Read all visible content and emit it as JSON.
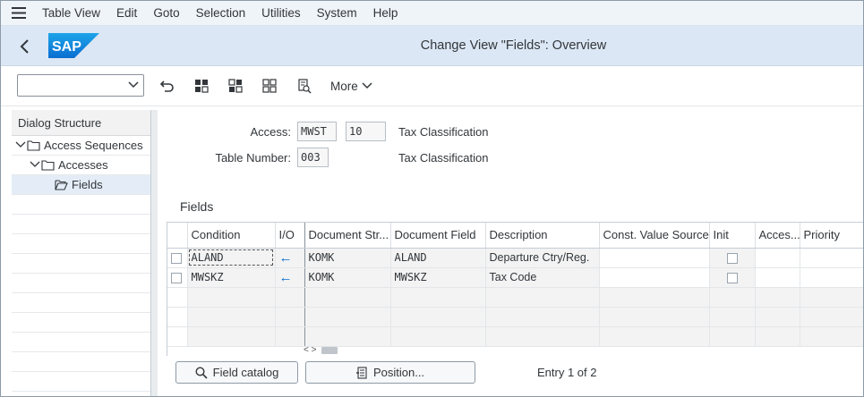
{
  "menu": {
    "items": [
      "Table View",
      "Edit",
      "Goto",
      "Selection",
      "Utilities",
      "System",
      "Help"
    ]
  },
  "titlebar": {
    "logo_text": "SAP",
    "title": "Change View \"Fields\": Overview"
  },
  "toolbar": {
    "command_field_value": "",
    "more_label": "More"
  },
  "dialog_structure": {
    "header": "Dialog Structure",
    "items": [
      {
        "label": "Access Sequences",
        "level": 0,
        "expanded": true,
        "selected": false
      },
      {
        "label": "Accesses",
        "level": 1,
        "expanded": true,
        "selected": false
      },
      {
        "label": "Fields",
        "level": 2,
        "expanded": false,
        "selected": true
      }
    ]
  },
  "header_fields": {
    "access_label": "Access:",
    "access_value": "MWST",
    "access_number": "10",
    "access_desc": "Tax Classification",
    "table_label": "Table Number:",
    "table_value": "003",
    "table_desc": "Tax Classification"
  },
  "fields_section": {
    "title": "Fields",
    "columns": [
      "Condition",
      "I/O",
      "Document Str...",
      "Document Field",
      "Description",
      "Const. Value Source",
      "Init",
      "Acces...",
      "Priority"
    ],
    "rows": [
      {
        "condition": "ALAND",
        "io": "←",
        "doc_structure": "KOMK",
        "doc_field": "ALAND",
        "description": "Departure Ctry/Reg.",
        "const_value_source": "",
        "init": false,
        "access": "",
        "priority": ""
      },
      {
        "condition": "MWSKZ",
        "io": "←",
        "doc_structure": "KOMK",
        "doc_field": "MWSKZ",
        "description": "Tax Code",
        "const_value_source": "",
        "init": false,
        "access": "",
        "priority": ""
      }
    ]
  },
  "footer": {
    "field_catalog_label": "Field catalog",
    "position_label": "Position...",
    "entry_text": "Entry 1 of 2"
  },
  "colors": {
    "menubar_bg": "#eff4f9",
    "titlebar_bg": "#dbe7f4",
    "sap_blue": "#0a6ed1",
    "readonly_cell": "#f3f3f3"
  }
}
